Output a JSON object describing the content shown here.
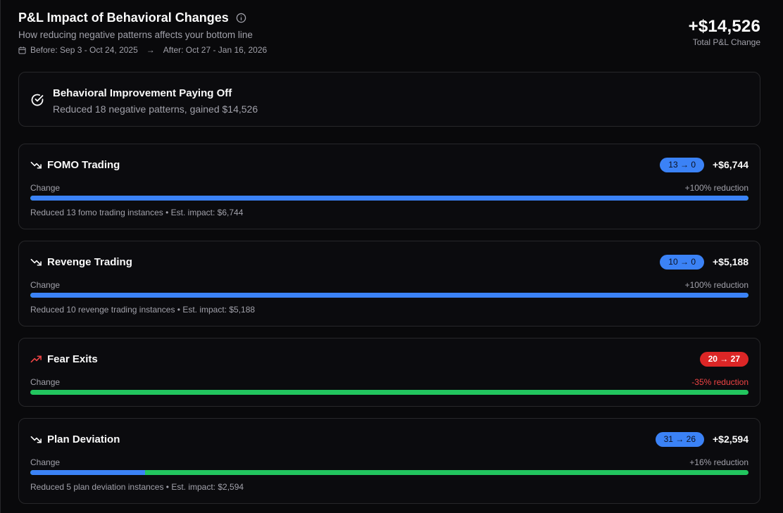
{
  "header": {
    "title": "P&L Impact of Behavioral Changes",
    "subtitle": "How reducing negative patterns affects your bottom line",
    "before": "Before: Sep 3 - Oct 24, 2025",
    "arrow": "→",
    "after": "After: Oct 27 - Jan 16, 2026",
    "icons": {
      "info": "info-icon",
      "calendar": "calendar-icon"
    }
  },
  "total": {
    "value": "+$14,526",
    "label": "Total P&L Change"
  },
  "banner": {
    "icon": "check-circle-icon",
    "title": "Behavioral Improvement Paying Off",
    "text": "Reduced 18 negative patterns, gained $14,526"
  },
  "colors": {
    "accent_blue": "#3b82f6",
    "success_green": "#22c55e",
    "danger_red": "#dc2626"
  },
  "patterns": [
    {
      "name": "FOMO Trading",
      "trend": "trending-down-icon",
      "badge": "13 → 0",
      "badge_color": "blue",
      "impact": "+$6,744",
      "change_label": "Change",
      "reduction": "+100% reduction",
      "reduction_fraction": 1.0,
      "description": "Reduced 13 fomo trading instances • Est. impact: $6,744"
    },
    {
      "name": "Revenge Trading",
      "trend": "trending-down-icon",
      "badge": "10 → 0",
      "badge_color": "blue",
      "impact": "+$5,188",
      "change_label": "Change",
      "reduction": "+100% reduction",
      "reduction_fraction": 1.0,
      "description": "Reduced 10 revenge trading instances • Est. impact: $5,188"
    },
    {
      "name": "Fear Exits",
      "trend": "trending-up-icon",
      "badge": "20 → 27",
      "badge_color": "red",
      "impact": "",
      "change_label": "Change",
      "reduction": "-35% reduction",
      "reduction_fraction": 0.0,
      "description": ""
    },
    {
      "name": "Plan Deviation",
      "trend": "trending-down-icon",
      "badge": "31 → 26",
      "badge_color": "blue",
      "impact": "+$2,594",
      "change_label": "Change",
      "reduction": "+16% reduction",
      "reduction_fraction": 0.16,
      "description": "Reduced 5 plan deviation instances • Est. impact: $2,594"
    }
  ]
}
